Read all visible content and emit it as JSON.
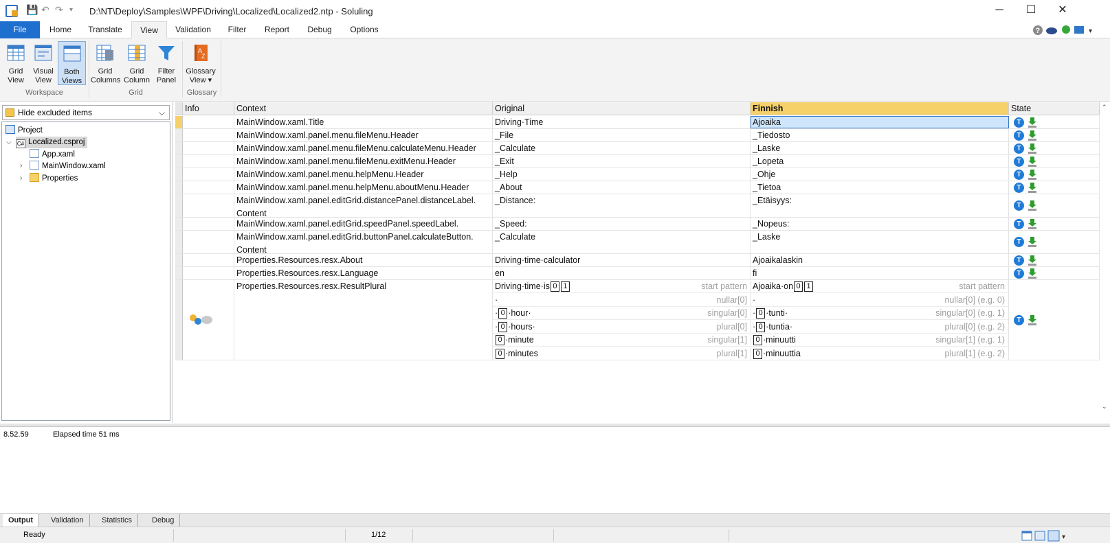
{
  "window": {
    "title": "D:\\NT\\Deploy\\Samples\\WPF\\Driving\\Localized\\Localized2.ntp  -  Soluling",
    "minimize": "─",
    "maximize": "☐",
    "close": "✕"
  },
  "tabs": [
    "File",
    "Home",
    "Translate",
    "View",
    "Validation",
    "Filter",
    "Report",
    "Debug",
    "Options"
  ],
  "ribbon": {
    "buttons": [
      {
        "line1": "Grid",
        "line2": "View"
      },
      {
        "line1": "Visual",
        "line2": "View"
      },
      {
        "line1": "Both",
        "line2": "Views"
      },
      {
        "line1": "Grid",
        "line2": "Columns"
      },
      {
        "line1": "Grid",
        "line2": "Column"
      },
      {
        "line1": "Filter",
        "line2": "Panel"
      },
      {
        "line1": "Glossary",
        "line2": "View ▾"
      }
    ],
    "groups": [
      "Workspace",
      "Grid",
      "Glossary"
    ]
  },
  "left": {
    "filter": "Hide excluded items",
    "tree": [
      "Project",
      "Localized.csproj",
      "App.xaml",
      "MainWindow.xaml",
      "Properties"
    ]
  },
  "grid": {
    "headers": [
      "Info",
      "Context",
      "Original",
      "Finnish",
      "State"
    ],
    "rows": [
      {
        "context": "MainWindow.xaml.Title",
        "original": "Driving·Time",
        "finnish": "Ajoaika"
      },
      {
        "context": "MainWindow.xaml.panel.menu.fileMenu.Header",
        "original": "_File",
        "finnish": "_Tiedosto"
      },
      {
        "context": "MainWindow.xaml.panel.menu.fileMenu.calculateMenu.Header",
        "original": "_Calculate",
        "finnish": "_Laske"
      },
      {
        "context": "MainWindow.xaml.panel.menu.fileMenu.exitMenu.Header",
        "original": "_Exit",
        "finnish": "_Lopeta"
      },
      {
        "context": "MainWindow.xaml.panel.menu.helpMenu.Header",
        "original": "_Help",
        "finnish": "_Ohje"
      },
      {
        "context": "MainWindow.xaml.panel.menu.helpMenu.aboutMenu.Header",
        "original": "_About",
        "finnish": "_Tietoa"
      },
      {
        "context": "MainWindow.xaml.panel.editGrid.distancePanel.distanceLabel.",
        "context2": "Content",
        "original": "_Distance:",
        "finnish": "_Etäisyys:"
      },
      {
        "context": "MainWindow.xaml.panel.editGrid.speedPanel.speedLabel.",
        "original": "_Speed:",
        "finnish": "_Nopeus:"
      },
      {
        "context": "MainWindow.xaml.panel.editGrid.buttonPanel.calculateButton.",
        "context2": "Content",
        "original": "_Calculate",
        "finnish": "_Laske"
      },
      {
        "context": "Properties.Resources.resx.About",
        "original": "Driving·time·calculator",
        "finnish": "Ajoaikalaskin"
      },
      {
        "context": "Properties.Resources.resx.Language",
        "original": "en",
        "finnish": "fi"
      }
    ],
    "plural": {
      "context": "Properties.Resources.resx.ResultPlural",
      "original": [
        {
          "pre": "Driving·time·is",
          "ph": [
            "0",
            "1"
          ],
          "post": "",
          "hint": "start pattern"
        },
        {
          "pre": "·",
          "ph": [],
          "post": "",
          "hint": "nullar[0]"
        },
        {
          "pre": "·",
          "ph": [
            "0"
          ],
          "post": "·hour·",
          "hint": "singular[0]"
        },
        {
          "pre": "·",
          "ph": [
            "0"
          ],
          "post": "·hours·",
          "hint": "plural[0]"
        },
        {
          "pre": "",
          "ph": [
            "0"
          ],
          "post": "·minute",
          "hint": "singular[1]"
        },
        {
          "pre": "",
          "ph": [
            "0"
          ],
          "post": "·minutes",
          "hint": "plural[1]"
        }
      ],
      "finnish": [
        {
          "pre": "Ajoaika·on",
          "ph": [
            "0",
            "1"
          ],
          "post": "",
          "hint": "start pattern"
        },
        {
          "pre": "·",
          "ph": [],
          "post": "",
          "hint": "nullar[0] (e.g. 0)"
        },
        {
          "pre": "·",
          "ph": [
            "0"
          ],
          "post": "·tunti·",
          "hint": "singular[0] (e.g. 1)"
        },
        {
          "pre": "·",
          "ph": [
            "0"
          ],
          "post": "·tuntia·",
          "hint": "plural[0] (e.g. 2)"
        },
        {
          "pre": "",
          "ph": [
            "0"
          ],
          "post": "·minuutti",
          "hint": "singular[1] (e.g. 1)"
        },
        {
          "pre": "",
          "ph": [
            "0"
          ],
          "post": "·minuuttia",
          "hint": "plural[1] (e.g. 2)"
        }
      ]
    },
    "state_letter": "T"
  },
  "output": {
    "time": "8.52.59",
    "message": "Elapsed time 51 ms"
  },
  "output_tabs": [
    "Output",
    "Validation",
    "Statistics",
    "Debug"
  ],
  "status": {
    "text": "Ready",
    "page": "1/12"
  },
  "colors": {
    "accent": "#1e6fce",
    "finnish_header": "#f6d16a",
    "state_blue": "#1f7bd6",
    "download_green": "#2e9d2e"
  }
}
